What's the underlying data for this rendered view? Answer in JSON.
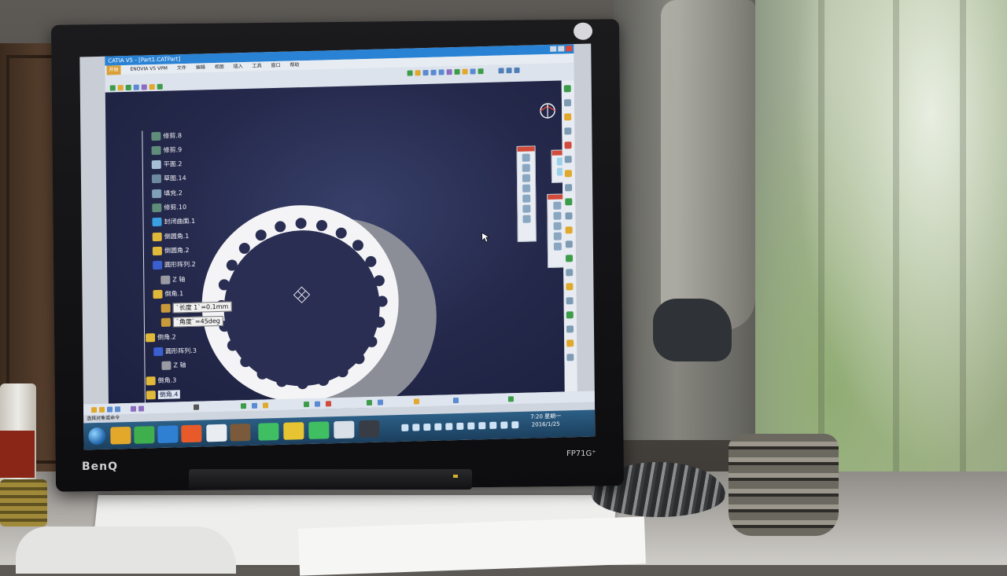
{
  "monitor": {
    "brand": "BenQ",
    "model": "FP71G⁺"
  },
  "catia": {
    "title": "CATIA V5 - [Part1.CATPart]",
    "menu": [
      "开始",
      "ENOVIA V5 VPM",
      "文件",
      "编辑",
      "视图",
      "插入",
      "工具",
      "窗口",
      "帮助"
    ],
    "tree": [
      {
        "label": "修剪.8",
        "icon": "trim-icon",
        "depth": 1
      },
      {
        "label": "修剪.9",
        "icon": "trim-icon",
        "depth": 1
      },
      {
        "label": "平面.2",
        "icon": "plane-icon",
        "depth": 1
      },
      {
        "label": "草图.14",
        "icon": "sketch-icon",
        "depth": 1
      },
      {
        "label": "填充.2",
        "icon": "fill-icon",
        "depth": 1
      },
      {
        "label": "修剪.10",
        "icon": "trim-icon",
        "depth": 1
      },
      {
        "label": "封闭曲面.1",
        "icon": "close-surface-icon",
        "depth": 1
      },
      {
        "label": "倒圆角.1",
        "icon": "fillet-icon",
        "depth": 1
      },
      {
        "label": "倒圆角.2",
        "icon": "fillet-icon",
        "depth": 1
      },
      {
        "label": "圆形阵列.2",
        "icon": "circular-pattern-icon",
        "depth": 1
      },
      {
        "label": "Z 轴",
        "icon": "axis-icon",
        "depth": 2
      },
      {
        "label": "倒角.1",
        "icon": "chamfer-icon",
        "depth": 1
      },
      {
        "label": "`长度 1`=0.1mm",
        "icon": "parameter-icon",
        "depth": 2,
        "boxed": true
      },
      {
        "label": "`角度`=45deg",
        "icon": "parameter-icon",
        "depth": 2,
        "boxed": true
      },
      {
        "label": "倒角.2",
        "icon": "chamfer-icon",
        "depth": 0
      },
      {
        "label": "圆形阵列.3",
        "icon": "circular-pattern-icon",
        "depth": 1
      },
      {
        "label": "Z 轴",
        "icon": "axis-icon",
        "depth": 2
      },
      {
        "label": "倒角.3",
        "icon": "chamfer-icon",
        "depth": 0
      },
      {
        "label": "倒角.4",
        "icon": "chamfer-icon",
        "depth": 0,
        "selected": true
      }
    ],
    "status": "选择对象或命令"
  },
  "taskbar": {
    "time": "7:20 星期一",
    "date": "2016/1/25"
  },
  "colors": {
    "viewport_center": "#38406a",
    "viewport_edge": "#1c2040",
    "taskbar": "#2c5f86",
    "titlebar": "#2a82d4"
  }
}
